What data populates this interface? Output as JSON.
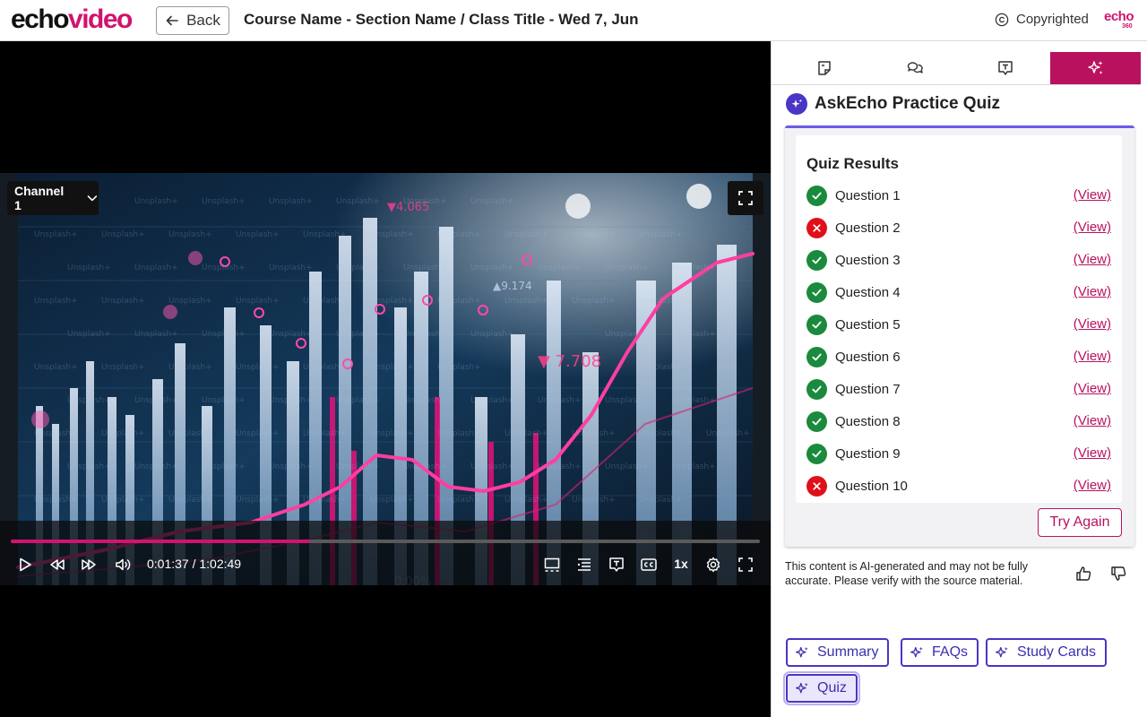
{
  "header": {
    "logo_part1": "echo",
    "logo_part2": "video",
    "back_label": "Back",
    "breadcrumb": "Course Name - Section Name / Class Title - Wed 7, Jun",
    "copyright_label": "Copyrighted",
    "brand_mark": "echo",
    "brand_mark_sub": "360"
  },
  "player": {
    "channel_label": "Channel 1",
    "time": "0:01:37 / 1:02:49",
    "progress": 0.4,
    "speed": "1x",
    "accent": "#d1136f"
  },
  "panel": {
    "tabs": [
      {
        "icon": "notes-icon",
        "active": false
      },
      {
        "icon": "discussion-icon",
        "active": false
      },
      {
        "icon": "transcript-icon",
        "active": false
      },
      {
        "icon": "ai-sparkle-icon",
        "active": true
      }
    ],
    "title": "AskEcho Practice Quiz",
    "quiz": {
      "results_title": "Quiz Results",
      "questions": [
        {
          "label": "Question 1",
          "correct": true,
          "view": "(View)"
        },
        {
          "label": "Question 2",
          "correct": false,
          "view": "(View)"
        },
        {
          "label": "Question 3",
          "correct": true,
          "view": "(View)"
        },
        {
          "label": "Question 4",
          "correct": true,
          "view": "(View)"
        },
        {
          "label": "Question 5",
          "correct": true,
          "view": "(View)"
        },
        {
          "label": "Question 6",
          "correct": true,
          "view": "(View)"
        },
        {
          "label": "Question 7",
          "correct": true,
          "view": "(View)"
        },
        {
          "label": "Question 8",
          "correct": true,
          "view": "(View)"
        },
        {
          "label": "Question 9",
          "correct": true,
          "view": "(View)"
        },
        {
          "label": "Question 10",
          "correct": false,
          "view": "(View)"
        }
      ],
      "try_again": "Try Again"
    },
    "disclaimer": "This content is AI-generated and may not be fully accurate. Please verify with the source material.",
    "actions": {
      "summary": "Summary",
      "faqs": "FAQs",
      "study_cards": "Study Cards",
      "quiz": "Quiz"
    }
  },
  "colors": {
    "brand": "#d1136f",
    "active_tab": "#b8125f",
    "ai_accent": "#4a36c4",
    "correct": "#1a8a3c",
    "incorrect": "#e0101a"
  }
}
